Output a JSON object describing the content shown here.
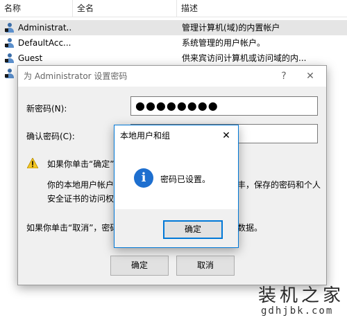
{
  "list": {
    "columns": [
      "名称",
      "全名",
      "描述"
    ],
    "rows": [
      {
        "name": "Administrat...",
        "fullname": "",
        "desc": "管理计算机(域)的内置帐户"
      },
      {
        "name": "DefaultAcc...",
        "fullname": "",
        "desc": "系统管理的用户帐户。"
      },
      {
        "name": "Guest",
        "fullname": "",
        "desc": "供来宾访问计算机或访问域的内..."
      }
    ]
  },
  "password_dialog": {
    "title": "为 Administrator 设置密码",
    "help": "?",
    "close": "✕",
    "new_password_label": "新密码(N):",
    "new_password_value": "●●●●●●●●",
    "confirm_label": "确认密码(C):",
    "confirm_value": "",
    "warning_line": "如果你单击“确定”",
    "info_line1": "你的本地用户帐户",
    "info_line1_tail": "丰，保存的密码和个人",
    "info_line2": "安全证书的访问权",
    "cancel_note": "如果你单击“取消”，密码",
    "cancel_note_tail": "数据。",
    "ok": "确定",
    "cancel": "取消"
  },
  "msgbox": {
    "title": "本地用户和组",
    "close": "✕",
    "icon_glyph": "i",
    "message": "密码已设置。",
    "ok": "确定"
  },
  "watermark": {
    "cn": "装机之家",
    "url": "gdhjbk.com"
  }
}
